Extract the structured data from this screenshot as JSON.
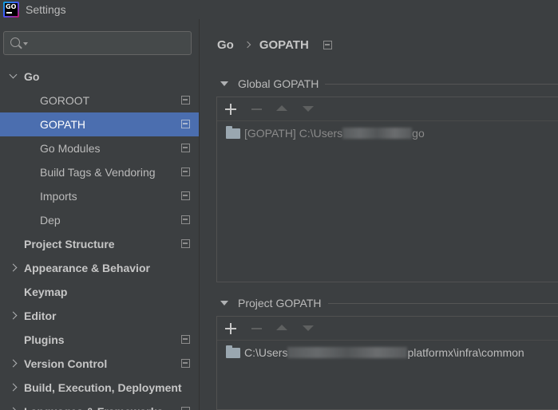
{
  "window": {
    "title": "Settings",
    "app_icon_text": "GO"
  },
  "search": {
    "placeholder": "",
    "value": ""
  },
  "tree": [
    {
      "label": "Go",
      "level": 0,
      "bold": true,
      "arrow": "down",
      "project_icon": false,
      "selected": false
    },
    {
      "label": "GOROOT",
      "level": 1,
      "bold": false,
      "arrow": "",
      "project_icon": true,
      "selected": false
    },
    {
      "label": "GOPATH",
      "level": 1,
      "bold": false,
      "arrow": "",
      "project_icon": true,
      "selected": true
    },
    {
      "label": "Go Modules",
      "level": 1,
      "bold": false,
      "arrow": "",
      "project_icon": true,
      "selected": false
    },
    {
      "label": "Build Tags & Vendoring",
      "level": 1,
      "bold": false,
      "arrow": "",
      "project_icon": true,
      "selected": false
    },
    {
      "label": "Imports",
      "level": 1,
      "bold": false,
      "arrow": "",
      "project_icon": true,
      "selected": false
    },
    {
      "label": "Dep",
      "level": 1,
      "bold": false,
      "arrow": "",
      "project_icon": true,
      "selected": false
    },
    {
      "label": "Project Structure",
      "level": 0,
      "bold": true,
      "arrow": "",
      "project_icon": true,
      "selected": false
    },
    {
      "label": "Appearance & Behavior",
      "level": 0,
      "bold": true,
      "arrow": "right",
      "project_icon": false,
      "selected": false
    },
    {
      "label": "Keymap",
      "level": 0,
      "bold": true,
      "arrow": "",
      "project_icon": false,
      "selected": false
    },
    {
      "label": "Editor",
      "level": 0,
      "bold": true,
      "arrow": "right",
      "project_icon": false,
      "selected": false
    },
    {
      "label": "Plugins",
      "level": 0,
      "bold": true,
      "arrow": "",
      "project_icon": true,
      "selected": false
    },
    {
      "label": "Version Control",
      "level": 0,
      "bold": true,
      "arrow": "right",
      "project_icon": true,
      "selected": false
    },
    {
      "label": "Build, Execution, Deployment",
      "level": 0,
      "bold": true,
      "arrow": "right",
      "project_icon": false,
      "selected": false
    },
    {
      "label": "Languages & Frameworks",
      "level": 0,
      "bold": true,
      "arrow": "right",
      "project_icon": true,
      "selected": false
    }
  ],
  "breadcrumb": {
    "parent": "Go",
    "current": "GOPATH"
  },
  "global_gopath": {
    "title": "Global GOPATH",
    "entry_prefix": "[GOPATH] C:\\Users",
    "entry_suffix": "go"
  },
  "project_gopath": {
    "title": "Project GOPATH",
    "entry_prefix": "C:\\Users",
    "entry_suffix": "platformx\\infra\\common"
  },
  "colors": {
    "selection": "#4b6eaf",
    "background": "#3c3f41",
    "text": "#bbbbbb"
  }
}
